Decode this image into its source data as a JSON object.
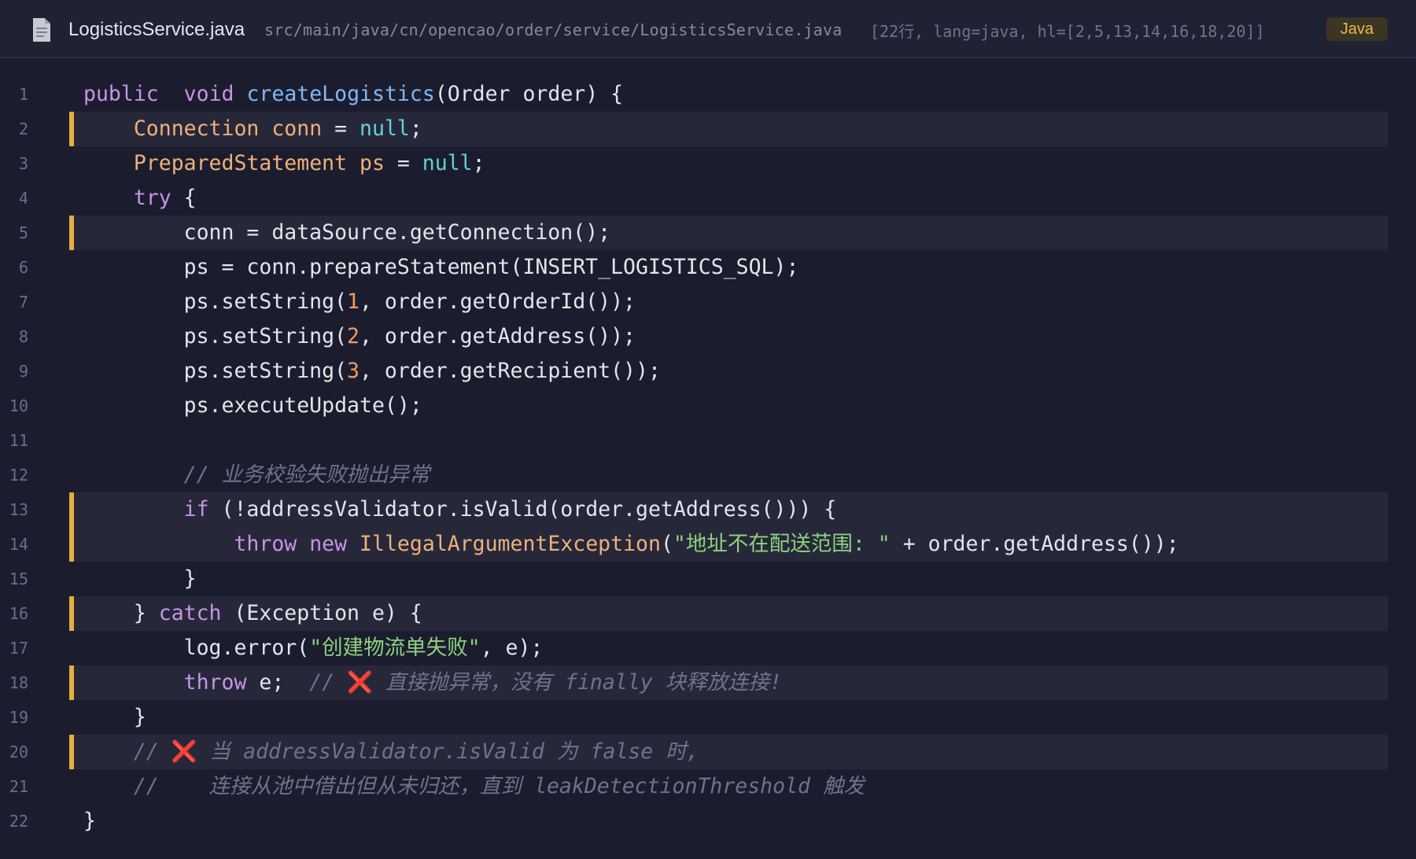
{
  "header": {
    "filename": "LogisticsService.java",
    "path": "src/main/java/cn/opencao/order/service/LogisticsService.java",
    "meta": "[22行, lang=java, hl=[2,5,13,14,16,18,20]]",
    "language": "Java"
  },
  "colors": {
    "background": "#1b1d2e",
    "highlight_bar": "#e6ae3a",
    "keyword": "#c893e6",
    "function": "#7fb7f5",
    "type": "#eeb07a",
    "string": "#8fd17e",
    "comment": "#6f7387"
  },
  "code": {
    "highlighted_lines": [
      2,
      5,
      13,
      14,
      16,
      18,
      20
    ],
    "lines": [
      {
        "n": "1",
        "hl": false,
        "tokens": [
          [
            "kw",
            "public"
          ],
          [
            "",
            "  "
          ],
          [
            "kw",
            "void"
          ],
          [
            "",
            " "
          ],
          [
            "fn",
            "createLogistics"
          ],
          [
            "",
            "(Order order) {"
          ]
        ]
      },
      {
        "n": "2",
        "hl": true,
        "tokens": [
          [
            "",
            "    "
          ],
          [
            "ty",
            "Connection conn"
          ],
          [
            "",
            " = "
          ],
          [
            "cn",
            "null"
          ],
          [
            "",
            ";"
          ]
        ]
      },
      {
        "n": "3",
        "hl": false,
        "tokens": [
          [
            "",
            "    "
          ],
          [
            "ty",
            "PreparedStatement ps"
          ],
          [
            "",
            " = "
          ],
          [
            "cn",
            "null"
          ],
          [
            "",
            ";"
          ]
        ]
      },
      {
        "n": "4",
        "hl": false,
        "tokens": [
          [
            "",
            "    "
          ],
          [
            "kw",
            "try"
          ],
          [
            "",
            " {"
          ]
        ]
      },
      {
        "n": "5",
        "hl": true,
        "tokens": [
          [
            "",
            "        conn = dataSource.getConnection();"
          ]
        ]
      },
      {
        "n": "6",
        "hl": false,
        "tokens": [
          [
            "",
            "        ps = conn.prepareStatement(INSERT_LOGISTICS_SQL);"
          ]
        ]
      },
      {
        "n": "7",
        "hl": false,
        "tokens": [
          [
            "",
            "        ps.setString("
          ],
          [
            "nm",
            "1"
          ],
          [
            "",
            ", order.getOrderId());"
          ]
        ]
      },
      {
        "n": "8",
        "hl": false,
        "tokens": [
          [
            "",
            "        ps.setString("
          ],
          [
            "nm",
            "2"
          ],
          [
            "",
            ", order.getAddress());"
          ]
        ]
      },
      {
        "n": "9",
        "hl": false,
        "tokens": [
          [
            "",
            "        ps.setString("
          ],
          [
            "nm",
            "3"
          ],
          [
            "",
            ", order.getRecipient());"
          ]
        ]
      },
      {
        "n": "10",
        "hl": false,
        "tokens": [
          [
            "",
            "        ps.executeUpdate();"
          ]
        ]
      },
      {
        "n": "11",
        "hl": false,
        "tokens": []
      },
      {
        "n": "12",
        "hl": false,
        "tokens": [
          [
            "",
            "        "
          ],
          [
            "cm",
            "// 业务校验失败抛出异常"
          ]
        ]
      },
      {
        "n": "13",
        "hl": true,
        "tokens": [
          [
            "",
            "        "
          ],
          [
            "kw",
            "if"
          ],
          [
            "",
            " (!addressValidator.isValid(order.getAddress())) {"
          ]
        ]
      },
      {
        "n": "14",
        "hl": true,
        "tokens": [
          [
            "",
            "            "
          ],
          [
            "kw",
            "throw"
          ],
          [
            "",
            " "
          ],
          [
            "kw",
            "new"
          ],
          [
            "",
            " "
          ],
          [
            "ty",
            "IllegalArgumentException"
          ],
          [
            "",
            "("
          ],
          [
            "st",
            "\"地址不在配送范围: \""
          ],
          [
            "",
            " + order.getAddress());"
          ]
        ]
      },
      {
        "n": "15",
        "hl": false,
        "tokens": [
          [
            "",
            "        }"
          ]
        ]
      },
      {
        "n": "16",
        "hl": true,
        "tokens": [
          [
            "",
            "    } "
          ],
          [
            "kw",
            "catch"
          ],
          [
            "",
            " (Exception e) {"
          ]
        ]
      },
      {
        "n": "17",
        "hl": false,
        "tokens": [
          [
            "",
            "        log.error("
          ],
          [
            "st",
            "\"创建物流单失败\""
          ],
          [
            "",
            ", e);"
          ]
        ]
      },
      {
        "n": "18",
        "hl": true,
        "tokens": [
          [
            "",
            "        "
          ],
          [
            "kw",
            "throw"
          ],
          [
            "",
            " e;  "
          ],
          [
            "cm",
            "// "
          ],
          [
            "x",
            "❌"
          ],
          [
            "cm",
            " 直接抛异常，没有 finally 块释放连接!"
          ]
        ]
      },
      {
        "n": "19",
        "hl": false,
        "tokens": [
          [
            "",
            "    }"
          ]
        ]
      },
      {
        "n": "20",
        "hl": true,
        "tokens": [
          [
            "",
            "    "
          ],
          [
            "cm",
            "// "
          ],
          [
            "x",
            "❌"
          ],
          [
            "cm",
            " 当 addressValidator.isValid 为 false 时,"
          ]
        ]
      },
      {
        "n": "21",
        "hl": false,
        "tokens": [
          [
            "",
            "    "
          ],
          [
            "cm",
            "//    连接从池中借出但从未归还，直到 leakDetectionThreshold 触发"
          ]
        ]
      },
      {
        "n": "22",
        "hl": false,
        "tokens": [
          [
            "",
            "}"
          ]
        ]
      }
    ]
  }
}
